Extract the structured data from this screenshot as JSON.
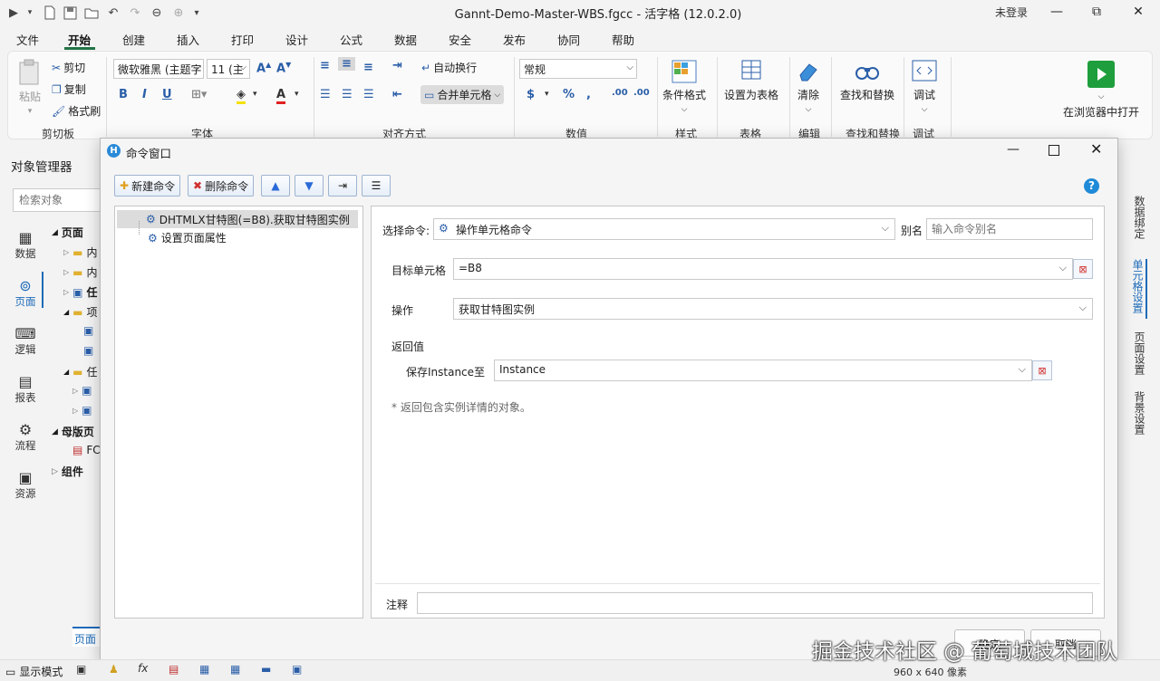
{
  "window": {
    "title": "Gannt-Demo-Master-WBS.fgcc - 活字格 (12.0.2.0)",
    "login": "未登录",
    "minimize": "—",
    "maximize": "⧉",
    "close": "✕"
  },
  "menu": [
    "文件",
    "开始",
    "创建",
    "插入",
    "打印",
    "设计",
    "公式",
    "数据",
    "安全",
    "发布",
    "协同",
    "帮助"
  ],
  "ribbon": {
    "paste": "粘贴",
    "cut": "剪切",
    "copy": "复制",
    "format_painter": "格式刷",
    "clipboard_group": "剪切板",
    "font_name": "微软雅黑 (主题字",
    "font_size": "11 (主",
    "bold": "B",
    "italic": "I",
    "underline": "U",
    "font_group": "字体",
    "wrap_text": "自动换行",
    "merge_cells": "合并单元格",
    "align_group": "对齐方式",
    "number_format": "常规",
    "currency": "$",
    "percent": "%",
    "comma": ",",
    "number_group": "数值",
    "conditional_format": "条件格式",
    "style_group": "样式",
    "set_as_table": "设置为表格",
    "table_group": "表格",
    "clear": "清除",
    "edit_group": "编辑",
    "find_replace": "查找和替换",
    "find_group": "查找和替换",
    "debug": "调试",
    "debug_group": "调试",
    "open_in_browser": "在浏览器中打开"
  },
  "object_manager": {
    "title": "对象管理器",
    "search_placeholder": "检索对象",
    "side_tabs": [
      "数据",
      "页面",
      "逻辑",
      "报表",
      "流程",
      "资源"
    ],
    "tree": {
      "pages": "页面",
      "item1": "内",
      "item2": "内",
      "item3": "任",
      "folder2": "项",
      "folder3": "任",
      "master": "母版页",
      "master_item": "FC",
      "components": "组件"
    },
    "bottom_tab": "页面"
  },
  "right_tabs": [
    "数据绑定",
    "单元格设置",
    "页面设置",
    "背景设置"
  ],
  "dialog": {
    "title": "命令窗口",
    "new_command": "新建命令",
    "delete_command": "删除命令",
    "commands": [
      {
        "label": "DHTMLX甘特图(=B8).获取甘特图实例"
      },
      {
        "label": "设置页面属性"
      }
    ],
    "select_command_label": "选择命令:",
    "select_command_value": "操作单元格命令",
    "alias_label": "别名",
    "alias_placeholder": "输入命令别名",
    "target_cell_label": "目标单元格",
    "target_cell_value": "=B8",
    "operation_label": "操作",
    "operation_value": "获取甘特图实例",
    "return_label": "返回值",
    "save_instance_label": "保存Instance至",
    "save_instance_value": "Instance",
    "hint": "* 返回包含实例详情的对象。",
    "comment_label": "注释",
    "ok": "确定",
    "cancel": "取消"
  },
  "statusbar": {
    "display_mode": "显示模式",
    "size": "960 x 640 像素"
  },
  "watermark": "掘金技术社区 @ 葡萄城技术团队"
}
